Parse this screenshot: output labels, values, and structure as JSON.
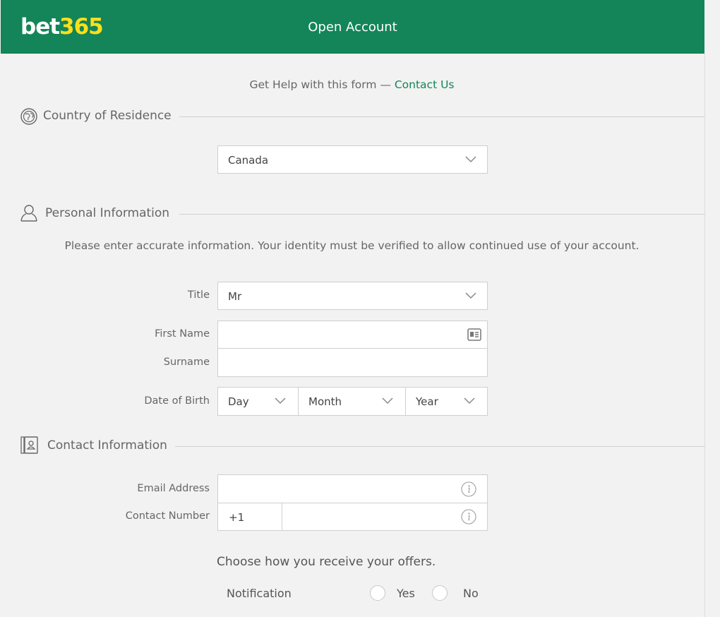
{
  "header": {
    "logo_part1": "bet",
    "logo_part2": "365",
    "title": "Open Account"
  },
  "help": {
    "prefix": "Get Help with this form — ",
    "link": "Contact Us"
  },
  "country_section": {
    "title": "Country of Residence",
    "icon": "globe-icon",
    "selected": "Canada"
  },
  "personal_section": {
    "title": "Personal Information",
    "icon": "person-icon",
    "description": "Please enter accurate information. Your identity must be verified to allow continued use of your account.",
    "title_label": "Title",
    "title_value": "Mr",
    "first_name_label": "First Name",
    "first_name_value": "",
    "surname_label": "Surname",
    "surname_value": "",
    "dob_label": "Date of Birth",
    "dob_day": "Day",
    "dob_month": "Month",
    "dob_year": "Year"
  },
  "contact_section": {
    "title": "Contact Information",
    "icon": "address-book-icon",
    "email_label": "Email Address",
    "email_value": "",
    "phone_label": "Contact Number",
    "phone_prefix": "+1",
    "phone_value": ""
  },
  "offers": {
    "heading": "Choose how you receive your offers.",
    "notification_label": "Notification",
    "yes": "Yes",
    "no": "No"
  },
  "colors": {
    "brand_green": "#138558",
    "logo_yellow": "#ffdf1b"
  }
}
